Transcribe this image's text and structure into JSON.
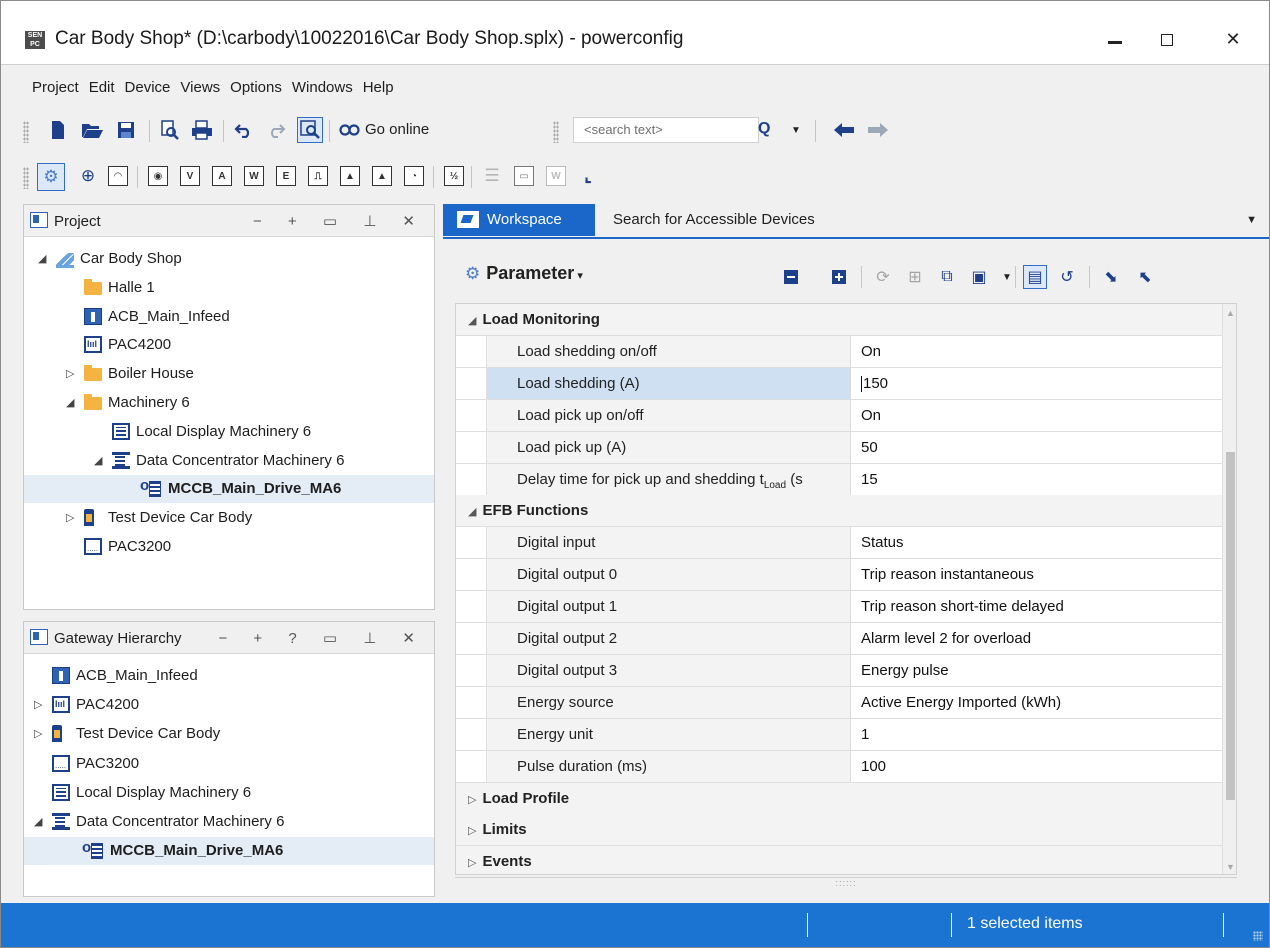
{
  "window": {
    "title": "Car Body Shop* (D:\\carbody\\10022016\\Car Body Shop.splx) - powerconfig",
    "app_icon_text": "SENTRON powerconfig"
  },
  "menu": [
    "Project",
    "Edit",
    "Device",
    "Views",
    "Options",
    "Windows",
    "Help"
  ],
  "toolbar": {
    "go_online_label": "Go online",
    "search_placeholder": "<search text>"
  },
  "project_panel": {
    "title": "Project",
    "tree": [
      {
        "label": "Car Body Shop",
        "level": 0,
        "expander": "expanded",
        "icon": "car-body-icon"
      },
      {
        "label": "Halle 1",
        "level": 1,
        "expander": "none",
        "icon": "folder-icon"
      },
      {
        "label": "ACB_Main_Infeed",
        "level": 1,
        "expander": "none",
        "icon": "acb-icon"
      },
      {
        "label": "PAC4200",
        "level": 1,
        "expander": "none",
        "icon": "pac4200-icon"
      },
      {
        "label": "Boiler House",
        "level": 1,
        "expander": "collapsed",
        "icon": "folder-icon"
      },
      {
        "label": "Machinery 6",
        "level": 1,
        "expander": "expanded",
        "icon": "folder-icon"
      },
      {
        "label": "Local Display Machinery 6",
        "level": 2,
        "expander": "none",
        "icon": "display-icon"
      },
      {
        "label": "Data Concentrator Machinery 6",
        "level": 2,
        "expander": "expanded",
        "icon": "concentrator-icon"
      },
      {
        "label": "MCCB_Main_Drive_MA6",
        "level": 3,
        "expander": "none",
        "icon": "mccb-icon",
        "selected": true
      },
      {
        "label": "Test Device Car Body",
        "level": 1,
        "expander": "collapsed",
        "icon": "test-device-icon"
      },
      {
        "label": "PAC3200",
        "level": 1,
        "expander": "none",
        "icon": "pac3200-icon"
      }
    ]
  },
  "gateway_panel": {
    "title": "Gateway Hierarchy",
    "tree": [
      {
        "label": "ACB_Main_Infeed",
        "level": 0,
        "expander": "none",
        "icon": "acb-icon"
      },
      {
        "label": "PAC4200",
        "level": 0,
        "expander": "collapsed",
        "icon": "pac4200-icon"
      },
      {
        "label": "Test Device Car Body",
        "level": 0,
        "expander": "collapsed",
        "icon": "test-device-icon"
      },
      {
        "label": "PAC3200",
        "level": 0,
        "expander": "none",
        "icon": "pac3200-icon"
      },
      {
        "label": "Local Display Machinery 6",
        "level": 0,
        "expander": "none",
        "icon": "display-icon"
      },
      {
        "label": "Data Concentrator Machinery 6",
        "level": 0,
        "expander": "expanded",
        "icon": "concentrator-icon"
      },
      {
        "label": "MCCB_Main_Drive_MA6",
        "level": 1,
        "expander": "none",
        "icon": "mccb-icon",
        "selected": true
      }
    ]
  },
  "workspace": {
    "tabs": [
      "Workspace",
      "Search for Accessible Devices"
    ],
    "parameter_label": "Parameter",
    "categories": [
      {
        "label": "Load Monitoring",
        "expanded": true,
        "rows": [
          {
            "name": "Load shedding on/off",
            "value": "On"
          },
          {
            "name": "Load shedding (A)",
            "value": "150",
            "selected": true
          },
          {
            "name": "Load pick up on/off",
            "value": "On"
          },
          {
            "name": "Load pick up (A)",
            "value": "50"
          },
          {
            "name": "Delay time for pick up and shedding t",
            "sub": "Load",
            "tail": " (s",
            "value": "15"
          }
        ]
      },
      {
        "label": "EFB Functions",
        "expanded": true,
        "rows": [
          {
            "name": "Digital input",
            "value": "Status"
          },
          {
            "name": "Digital output 0",
            "value": "Trip reason instantaneous"
          },
          {
            "name": "Digital output 1",
            "value": "Trip reason short-time delayed"
          },
          {
            "name": "Digital output 2",
            "value": "Alarm level 2 for overload"
          },
          {
            "name": "Digital output 3",
            "value": "Energy pulse"
          },
          {
            "name": "Energy source",
            "value": "Active Energy Imported (kWh)"
          },
          {
            "name": "Energy unit",
            "value": "1"
          },
          {
            "name": "Pulse duration (ms)",
            "value": "100"
          }
        ]
      },
      {
        "label": "Load Profile",
        "expanded": false,
        "rows": []
      },
      {
        "label": "Limits",
        "expanded": false,
        "rows": []
      },
      {
        "label": "Events",
        "expanded": false,
        "rows": []
      }
    ]
  },
  "status": {
    "selected_text": "1 selected items"
  },
  "colors": {
    "accent": "#1b67c9",
    "statusbar": "#1b74d1",
    "selection": "#cfe0f3"
  }
}
